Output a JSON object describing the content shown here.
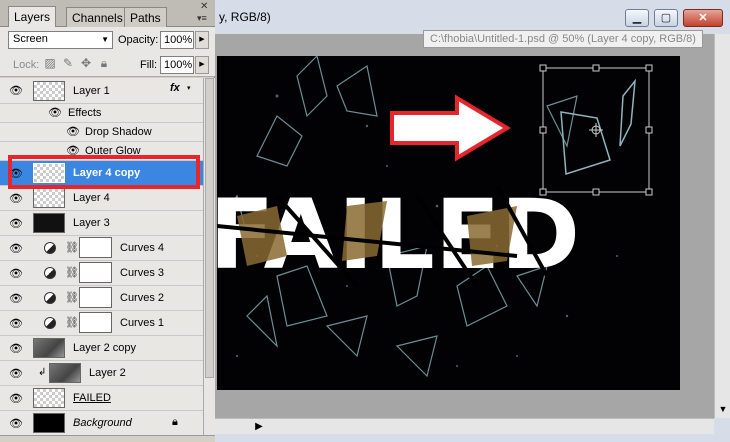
{
  "document": {
    "title_partial": "y, RGB/8)",
    "tooltip": "C:\\fhobia\\Untitled-1.psd @ 50% (Layer 4 copy, RGB/8)",
    "window_buttons": {
      "minimize": "▁",
      "restore": "▢",
      "close": "✕"
    },
    "artwork_text": "FAILED"
  },
  "panel": {
    "tabs": [
      {
        "label": "Layers",
        "active": true
      },
      {
        "label": "Channels",
        "active": false
      },
      {
        "label": "Paths",
        "active": false
      }
    ],
    "close_glyph": "✕",
    "menu_glyph": "▾≡",
    "blend_mode": "Screen",
    "opacity_label": "Opacity:",
    "opacity_value": "100%",
    "lock_label": "Lock:",
    "lock_icons": [
      "transparency-lock-icon",
      "brush-lock-icon",
      "move-lock-icon",
      "lock-all-icon"
    ],
    "fill_label": "Fill:",
    "fill_value": "100%",
    "layers": [
      {
        "name": "Layer 1",
        "thumb": "trans",
        "fx": "fx"
      },
      {
        "name": "Effects",
        "kind": "effects-header"
      },
      {
        "name": "Drop Shadow",
        "kind": "effect"
      },
      {
        "name": "Outer Glow",
        "kind": "effect"
      },
      {
        "name": "Layer 4 copy",
        "thumb": "trans",
        "selected": true
      },
      {
        "name": "Layer 4",
        "thumb": "trans"
      },
      {
        "name": "Layer 3",
        "thumb": "dark"
      },
      {
        "name": "Curves 4",
        "kind": "adjustment"
      },
      {
        "name": "Curves 3",
        "kind": "adjustment"
      },
      {
        "name": "Curves 2",
        "kind": "adjustment"
      },
      {
        "name": "Curves 1",
        "kind": "adjustment"
      },
      {
        "name": "Layer 2 copy",
        "thumb": "gray"
      },
      {
        "name": "Layer 2",
        "thumb": "gray",
        "clipped": true
      },
      {
        "name": "FAILED",
        "thumb": "trans",
        "style": "underline"
      },
      {
        "name": "Background",
        "thumb": "black",
        "style": "italic",
        "locked": true
      }
    ]
  },
  "colors": {
    "selection": "#3b86e0",
    "highlight_box": "#e6252c",
    "arrow": "#e6252c"
  }
}
